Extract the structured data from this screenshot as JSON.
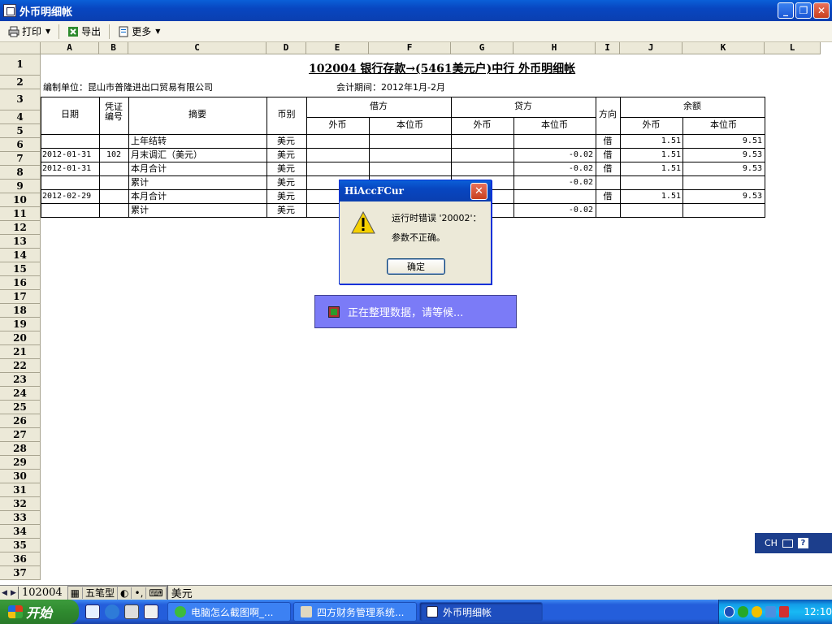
{
  "window": {
    "title": "外币明细帐"
  },
  "toolbar": {
    "print": "打印",
    "export": "导出",
    "more": "更多"
  },
  "columns": [
    "A",
    "B",
    "C",
    "D",
    "E",
    "F",
    "G",
    "H",
    "I",
    "J",
    "K",
    "L"
  ],
  "rows": [
    "1",
    "2",
    "3",
    "4",
    "5",
    "6",
    "7",
    "8",
    "9",
    "10",
    "11",
    "12",
    "13",
    "14",
    "15",
    "16",
    "17",
    "18",
    "19",
    "20",
    "21",
    "22",
    "23",
    "24",
    "25",
    "26",
    "27",
    "28",
    "29",
    "30",
    "31",
    "32",
    "33",
    "34",
    "35",
    "36",
    "37"
  ],
  "report": {
    "title": "102004  银行存款→(5461美元户)中行  外币明细帐",
    "unit": "编制单位：昆山市普隆进出口贸易有限公司",
    "period": "会计期间：2012年1月-2月",
    "headers": {
      "date": "日期",
      "voucher": "凭证编号",
      "summary": "摘要",
      "currency": "币别",
      "debit": "借方",
      "credit": "贷方",
      "direction": "方向",
      "balance": "余额",
      "foreign": "外币",
      "local": "本位币"
    },
    "lines": [
      {
        "date": "",
        "voucher": "",
        "summary": "上年结转",
        "currency": "美元",
        "debit_fc": "",
        "debit_lc": "",
        "credit_fc": "",
        "credit_lc": "",
        "dir": "借",
        "bal_fc": "1.51",
        "bal_lc": "9.51"
      },
      {
        "date": "2012-01-31",
        "voucher": "102",
        "summary": "月末调汇（美元）",
        "currency": "美元",
        "debit_fc": "",
        "debit_lc": "",
        "credit_fc": "",
        "credit_lc": "-0.02",
        "dir": "借",
        "bal_fc": "1.51",
        "bal_lc": "9.53"
      },
      {
        "date": "2012-01-31",
        "voucher": "",
        "summary": "本月合计",
        "currency": "美元",
        "debit_fc": "",
        "debit_lc": "",
        "credit_fc": "",
        "credit_lc": "-0.02",
        "dir": "借",
        "bal_fc": "1.51",
        "bal_lc": "9.53"
      },
      {
        "date": "",
        "voucher": "",
        "summary": "累计",
        "currency": "美元",
        "debit_fc": "",
        "debit_lc": "",
        "credit_fc": "",
        "credit_lc": "-0.02",
        "dir": "",
        "bal_fc": "",
        "bal_lc": ""
      },
      {
        "date": "2012-02-29",
        "voucher": "",
        "summary": "本月合计",
        "currency": "美元",
        "debit_fc": "",
        "debit_lc": "",
        "credit_fc": "",
        "credit_lc": "",
        "dir": "借",
        "bal_fc": "1.51",
        "bal_lc": "9.53"
      },
      {
        "date": "",
        "voucher": "",
        "summary": "累计",
        "currency": "美元",
        "debit_fc": "",
        "debit_lc": "",
        "credit_fc": "",
        "credit_lc": "-0.02",
        "dir": "",
        "bal_fc": "",
        "bal_lc": ""
      }
    ]
  },
  "dialog": {
    "title": "HiAccFCur",
    "line1": "运行时错误 '20002'：",
    "line2": "参数不正确。",
    "ok": "确定"
  },
  "progress": {
    "text": "正在整理数据，请等候..."
  },
  "ime": {
    "label": "CH",
    "help": "?"
  },
  "sheet_tabs": {
    "tab1": "102004",
    "ime_mode": "五笔型",
    "tab2": "美元"
  },
  "taskbar": {
    "start": "开始",
    "tasks": [
      "电脑怎么截图啊_...",
      "四方财务管理系统...",
      "外币明细帐"
    ],
    "clock": "12:10"
  },
  "colors": {
    "titlebar": "#0a46c0",
    "progress_bg": "#7b7bf7",
    "taskbar": "#245edb",
    "start": "#2f8a2f"
  }
}
